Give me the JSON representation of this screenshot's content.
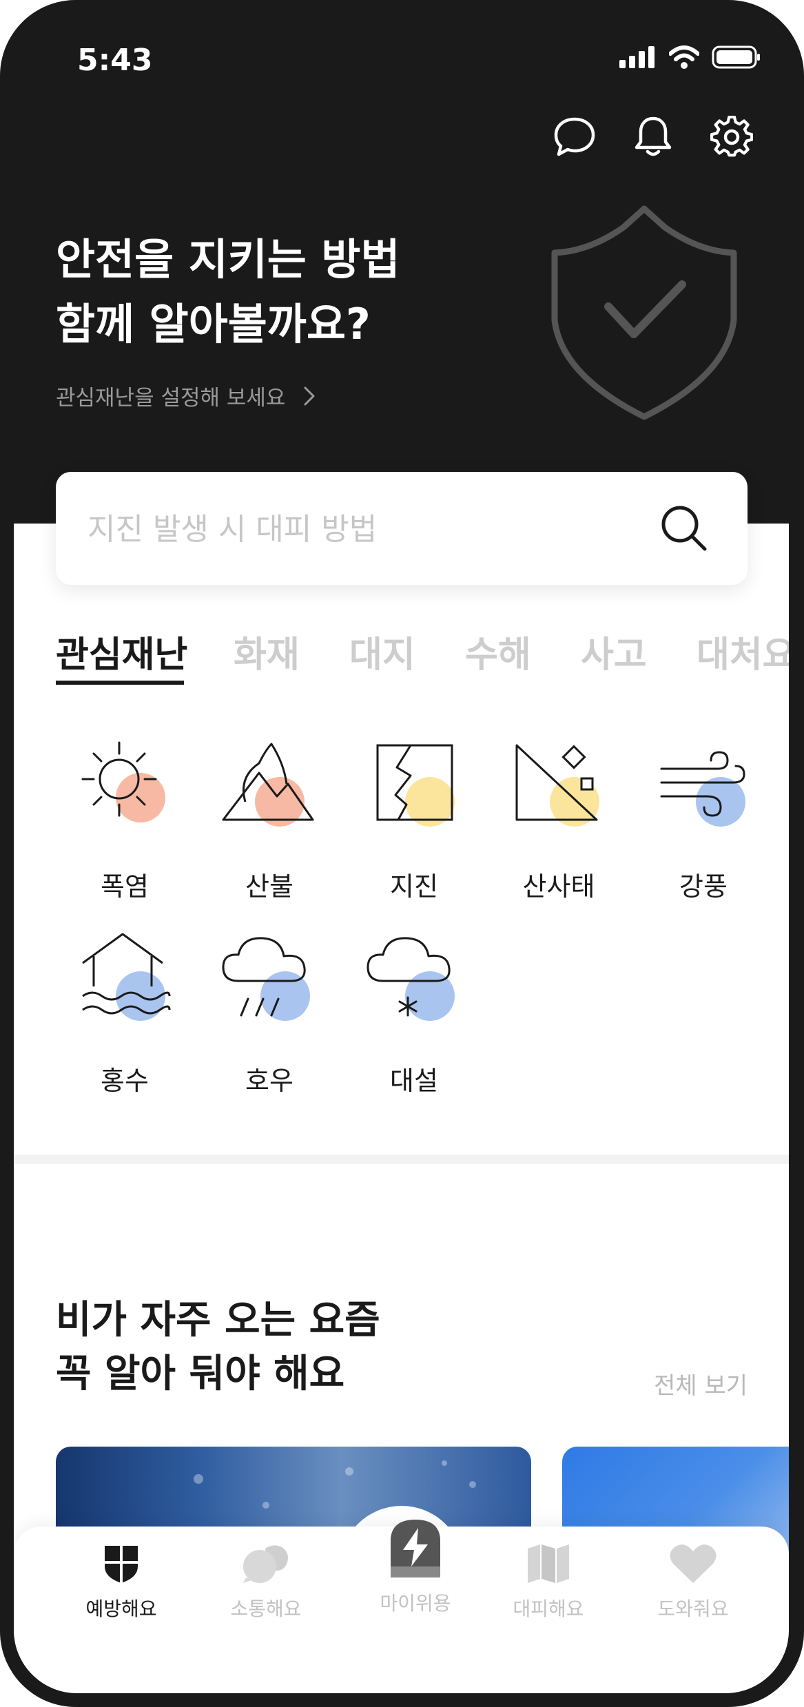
{
  "status_bar": {
    "time": "5:43"
  },
  "hero": {
    "title_line1": "안전을 지키는 방법",
    "title_line2": "함께 알아볼까요?",
    "link": "관심재난을 설정해 보세요"
  },
  "search": {
    "placeholder": "지진 발생 시 대피 방법"
  },
  "tabs": [
    "관심재난",
    "화재",
    "대지",
    "수해",
    "사고",
    "대처요"
  ],
  "disasters": [
    "폭염",
    "산불",
    "지진",
    "산사태",
    "강풍",
    "홍수",
    "호우",
    "대설"
  ],
  "section": {
    "title_line1": "비가 자주 오는 요즘",
    "title_line2": "꼭 알아 둬야 해요",
    "see_all": "전체 보기"
  },
  "bottom_nav": [
    "예방해요",
    "소통해요",
    "마이위용",
    "대피해요",
    "도와줘요"
  ],
  "colors": {
    "dark": "#1a1a1a",
    "orange": "#f7b9a3",
    "yellow": "#fbe59c",
    "blue": "#a9c4ef"
  }
}
